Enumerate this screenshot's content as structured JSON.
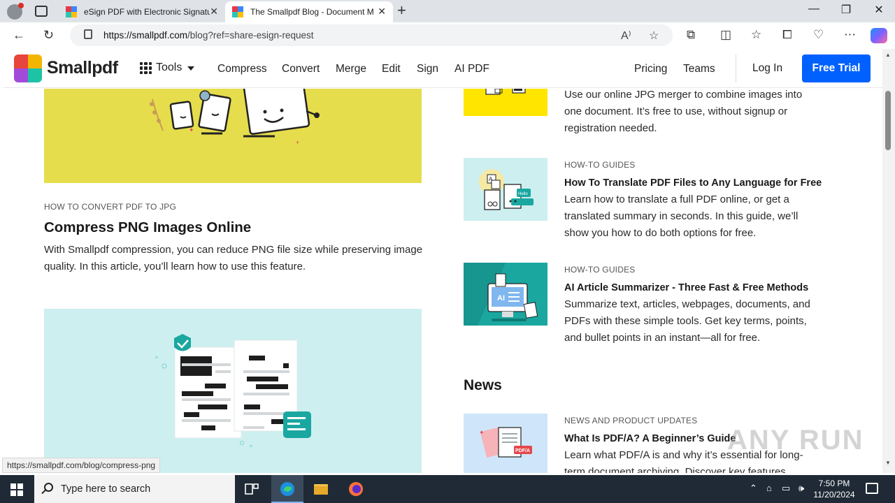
{
  "browser": {
    "tabs": [
      {
        "label": "eSign PDF with Electronic Signatu",
        "active": false
      },
      {
        "label": "The Smallpdf Blog - Document M",
        "active": true
      }
    ],
    "address": {
      "host": "https://smallpdf.com",
      "path": "/blog?ref=share-esign-request"
    },
    "window_controls": {
      "minimize": "—",
      "maximize": "❐",
      "close": "✕"
    },
    "status_url": "https://smallpdf.com/blog/compress-png"
  },
  "site_header": {
    "logo_text": "Smallpdf",
    "tools_label": "Tools",
    "nav": [
      "Compress",
      "Convert",
      "Merge",
      "Edit",
      "Sign",
      "AI PDF"
    ],
    "right_nav": [
      "Pricing",
      "Teams"
    ],
    "login_label": "Log In",
    "cta_label": "Free Trial"
  },
  "main_column": {
    "article": {
      "category": "HOW TO CONVERT PDF TO JPG",
      "title": "Compress PNG Images Online",
      "excerpt_line1": "With Smallpdf compression, you can reduce PNG file size while preserving image",
      "excerpt_line2": "quality. In this article, you’ll learn how to use this feature."
    }
  },
  "side_column": {
    "items": [
      {
        "category": "",
        "title": "",
        "lines": [
          "Use our online JPG merger to combine images into",
          "one document. It’s free to use, without signup or",
          "registration needed."
        ]
      },
      {
        "category": "HOW-TO GUIDES",
        "title": "How To Translate PDF Files to Any Language for Free",
        "lines": [
          "Learn how to translate a full PDF online, or get a",
          "translated summary in seconds. In this guide, we’ll",
          "show you how to do both options for free."
        ]
      },
      {
        "category": "HOW-TO GUIDES",
        "title": "AI Article Summarizer - Three Fast & Free Methods",
        "lines": [
          "Summarize text, articles, webpages, documents, and",
          "PDFs with these simple tools. Get key terms, points,",
          "and bullet points in an instant—all for free."
        ]
      }
    ],
    "news_heading": "News",
    "news": {
      "category": "NEWS AND PRODUCT UPDATES",
      "title": "What Is PDF/A? A Beginner’s Guide",
      "lines": [
        "Learn what PDF/A is and why it’s essential for long-",
        "term document archiving. Discover key features"
      ]
    }
  },
  "thumb_labels": {
    "ai": "AI",
    "pdfa": "PDF/A",
    "hello": "Hello"
  },
  "taskbar": {
    "search_placeholder": "Type here to search",
    "time": "7:50 PM",
    "date": "11/20/2024"
  },
  "watermark": "ANY RUN",
  "colors": {
    "brand_blue": "#0061fe",
    "yellow_card": "#e6dd4c",
    "teal_card": "#cdeff0",
    "teal_dark": "#1aa7a0"
  }
}
